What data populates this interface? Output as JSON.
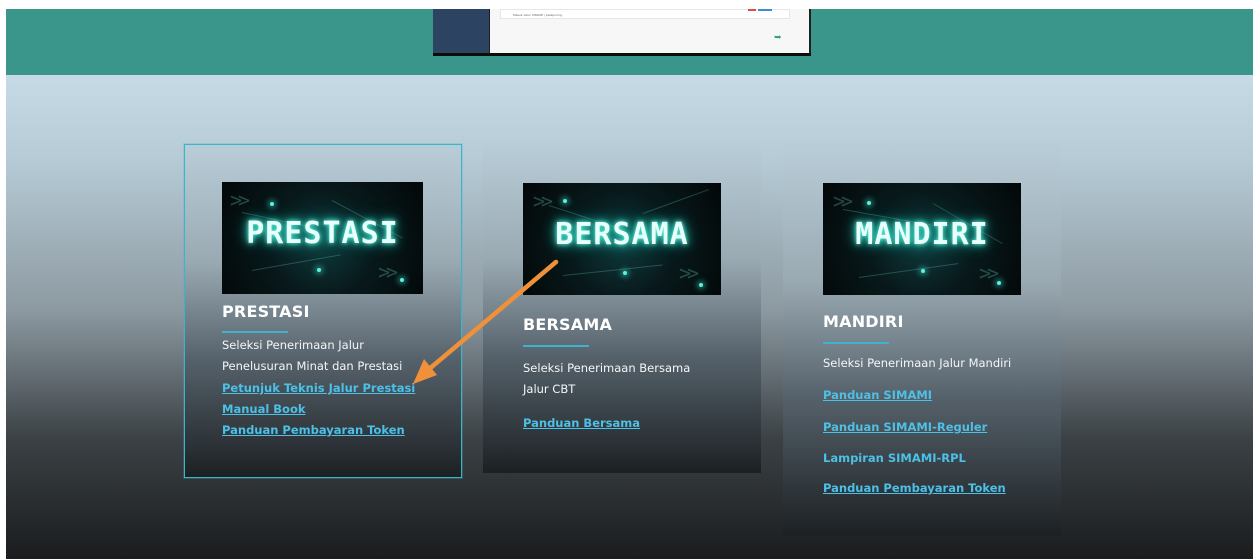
{
  "colors": {
    "header_band": "#3a968a",
    "link": "#4cc0e6",
    "divider": "#3fb2cf",
    "selected_border": "#3bb6c9",
    "neon_text": "#5cf4de",
    "annotation_arrow": "#f0913a"
  },
  "header_preview": {
    "caption": "Masuk Akun SIMAMI / pelaporing"
  },
  "cards": [
    {
      "banner_text": "PRESTASI",
      "title": "PRESTASI",
      "desc_lines": [
        "Seleksi Penerimaan Jalur",
        "Penelusuran Minat dan Prestasi"
      ],
      "links": [
        "Petunjuk Teknis Jalur Prestasi",
        "Manual Book",
        "Panduan Pembayaran Token"
      ]
    },
    {
      "banner_text": "BERSAMA",
      "title": "BERSAMA",
      "desc_lines": [
        "Seleksi Penerimaan Bersama",
        "Jalur CBT"
      ],
      "links": [
        "Panduan Bersama"
      ]
    },
    {
      "banner_text": "MANDIRI",
      "title": "MANDIRI",
      "desc_lines": [
        "Seleksi Penerimaan Jalur Mandiri"
      ],
      "links": [
        "Panduan SIMAMI",
        "Panduan SIMAMI-Reguler"
      ],
      "plain_item": "Lampiran SIMAMI-RPL",
      "last_link": "Panduan Pembayaran Token"
    }
  ]
}
